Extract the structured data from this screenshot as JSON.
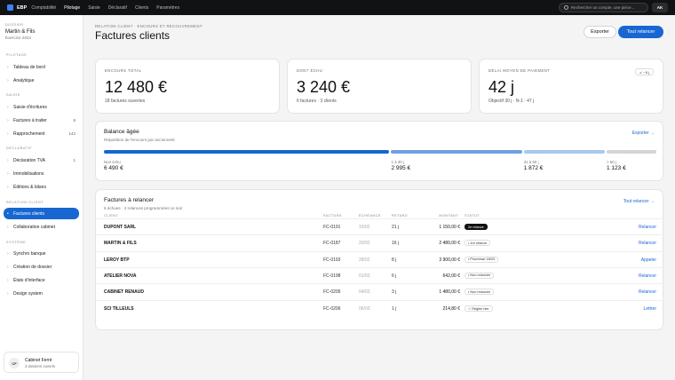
{
  "topbar": {
    "brand": "EBP",
    "nav": [
      "Comptabilité",
      "Pilotage",
      "Saisie",
      "Déclaratif",
      "Clients",
      "Paramètres"
    ],
    "search_placeholder": "Rechercher un compte, une pièce...",
    "user_initials": "AK"
  },
  "sidebar": {
    "dossier_label": "DOSSIER",
    "dossier_name": "Martin & Fils",
    "dossier_sub": "Exercice 2024",
    "sections": [
      {
        "title": "PILOTAGE",
        "items": [
          {
            "label": "Tableau de bord"
          },
          {
            "label": "Analytique"
          }
        ]
      },
      {
        "title": "SAISIE",
        "items": [
          {
            "label": "Saisie d'écritures"
          },
          {
            "label": "Factures à traiter",
            "count": "8"
          },
          {
            "label": "Rapprochement",
            "count": "142"
          }
        ]
      },
      {
        "title": "DÉCLARATIF",
        "items": [
          {
            "label": "Déclaration TVA",
            "count": "1"
          },
          {
            "label": "Immobilisations"
          },
          {
            "label": "Éditions & bilans"
          }
        ]
      },
      {
        "title": "RELATION CLIENT",
        "items": [
          {
            "label": "Factures clients"
          },
          {
            "label": "Collaboration cabinet"
          }
        ]
      },
      {
        "title": "SYSTÈME",
        "items": [
          {
            "label": "Synchro banque"
          },
          {
            "label": "Création de dossier"
          },
          {
            "label": "États d'interface"
          },
          {
            "label": "Design system"
          }
        ]
      }
    ],
    "cabinet": {
      "initials": "CF",
      "name": "Cabinet Ferré",
      "sub": "3 dossiers ouverts"
    }
  },
  "header": {
    "breadcrumb": "RELATION CLIENT · ENCOURS ET RECOUVREMENT",
    "title": "Factures clients",
    "export_label": "Exporter",
    "relance_label": "Tout relancer"
  },
  "kpis": [
    {
      "label": "ENCOURS TOTAL",
      "value": "12 480 €",
      "sub": "18 factures ouvertes"
    },
    {
      "label": "DONT ÉCHU",
      "value": "3 240 €",
      "sub": "6 factures · 3 clients"
    },
    {
      "label": "DÉLAI MOYEN DE PAIEMENT",
      "value": "42 j",
      "sub": "Objectif 30 j · N-1 : 47 j",
      "badge": "↙ −5 j"
    }
  ],
  "aging": {
    "title": "Balance âgée",
    "subtitle": "Répartition de l'encours par ancienneté",
    "link": "Exporter →",
    "buckets": [
      {
        "label": "Non échu",
        "value": "6 490 €",
        "share": 0.52,
        "color": "#1766d2"
      },
      {
        "label": "1 à 30 j",
        "value": "2 995 €",
        "share": 0.24,
        "color": "#6ea1e3"
      },
      {
        "label": "31 à 60 j",
        "value": "1 872 €",
        "share": 0.15,
        "color": "#a9c8ef"
      },
      {
        "label": "> 60 j",
        "value": "1 123 €",
        "share": 0.09,
        "color": "#d4d4d8"
      }
    ]
  },
  "relances": {
    "title": "Factures à relancer",
    "subtitle": "6 échues · 2 relances programmées ce soir",
    "link": "Tout relancer →",
    "columns": [
      "CLIENT",
      "FACTURE",
      "ÉCHÉANCE",
      "RETARD",
      "MONTANT",
      "STATUT"
    ],
    "rows": [
      {
        "client": "DUPONT SARL",
        "facture": "FC-0191",
        "echeance": "15/02",
        "retard": "21 j",
        "montant": "1 150,00 €",
        "statut": "2e relance",
        "statut_dark": true,
        "action": "Relancer"
      },
      {
        "client": "MARTIN & FILS",
        "facture": "FC-0187",
        "echeance": "20/02",
        "retard": "16 j",
        "montant": "2 480,00 €",
        "statut": "• 1re relance",
        "statut_dark": false,
        "action": "Relancer"
      },
      {
        "client": "LEROY BTP",
        "facture": "FC-0193",
        "echeance": "28/02",
        "retard": "8 j",
        "montant": "3 900,00 €",
        "statut": "• Promesse 18/03",
        "statut_dark": false,
        "action": "Appeler"
      },
      {
        "client": "ATELIER NOVA",
        "facture": "FC-0198",
        "echeance": "01/03",
        "retard": "6 j",
        "montant": "642,00 €",
        "statut": "• Non relancée",
        "statut_dark": false,
        "action": "Relancer"
      },
      {
        "client": "CABINET RENAUD",
        "facture": "FC-0205",
        "echeance": "04/03",
        "retard": "3 j",
        "montant": "1 480,00 €",
        "statut": "• Non relancée",
        "statut_dark": false,
        "action": "Relancer"
      },
      {
        "client": "SCI TILLEULS",
        "facture": "FC-0206",
        "echeance": "06/03",
        "retard": "1 j",
        "montant": "214,80 €",
        "statut": "✓ Réglée hier",
        "statut_dark": false,
        "action": "Lettrer"
      }
    ]
  }
}
